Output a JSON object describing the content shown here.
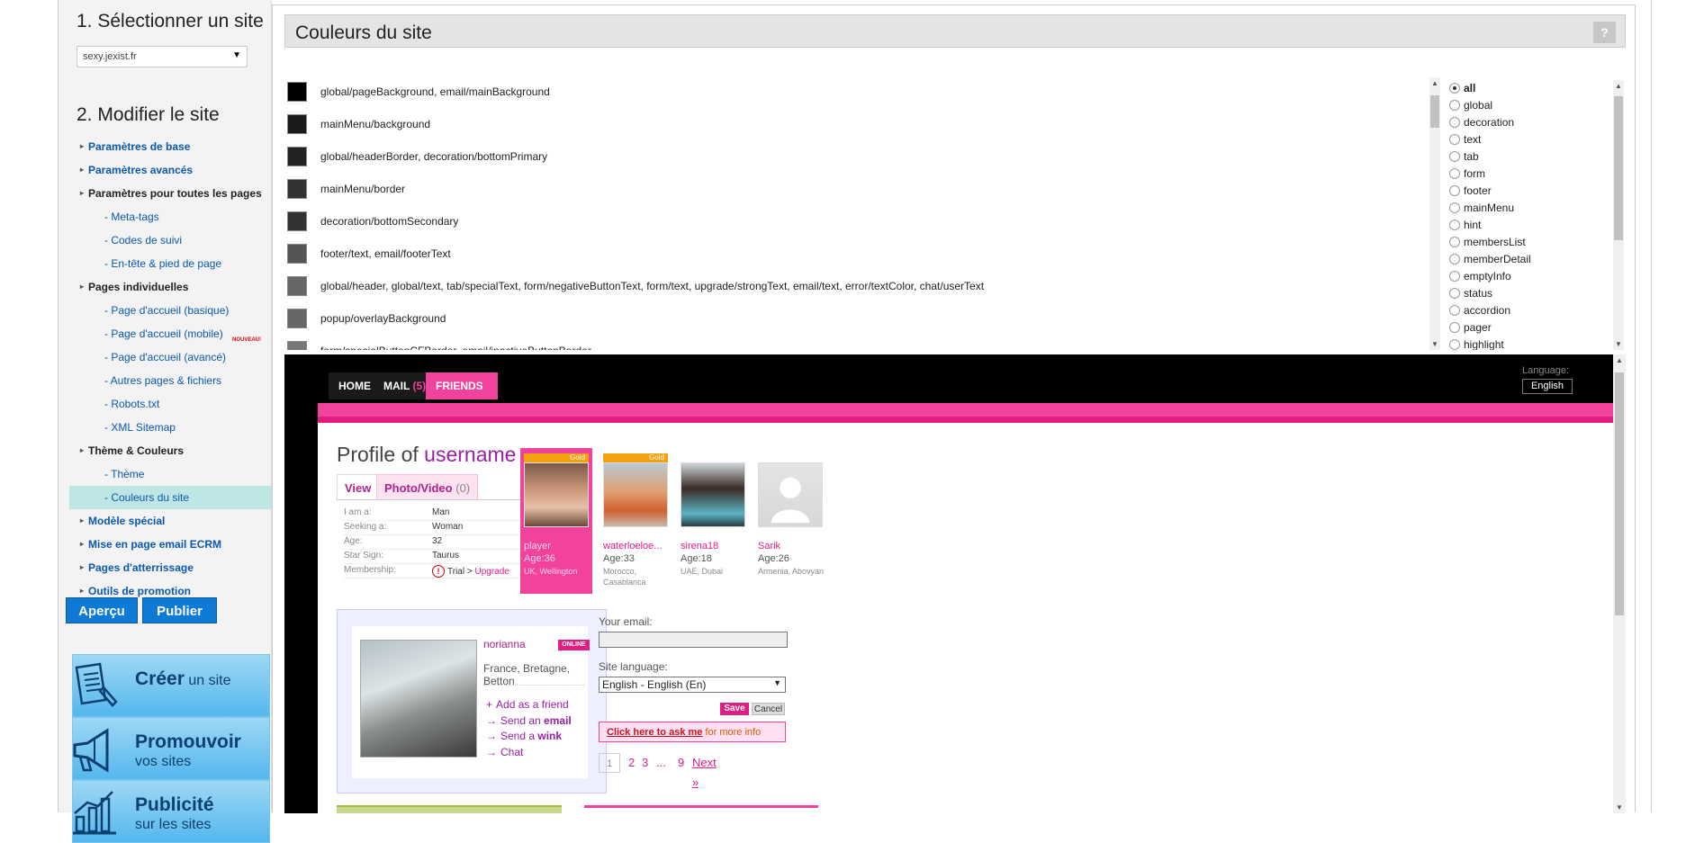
{
  "sidebar": {
    "step1_title": "1. Sélectionner un site",
    "site_value": "sexy.jexist.fr",
    "step2_title": "2. Modifier le site",
    "menu": [
      {
        "label": "Paramètres de base",
        "kind": "item"
      },
      {
        "label": "Paramètres avancés",
        "kind": "item"
      },
      {
        "label": "Paramètres pour toutes les pages",
        "kind": "item-dark"
      },
      {
        "label": "- Meta-tags",
        "kind": "sub"
      },
      {
        "label": "- Codes de suivi",
        "kind": "sub"
      },
      {
        "label": "- En-tête & pied de page",
        "kind": "sub"
      },
      {
        "label": "Pages individuelles",
        "kind": "item-dark"
      },
      {
        "label": "- Page d'accueil (basique)",
        "kind": "sub"
      },
      {
        "label": "- Page d'accueil (mobile)",
        "kind": "sub",
        "badge": "NOUVEAU!"
      },
      {
        "label": "- Page d'accueil (avancé)",
        "kind": "sub"
      },
      {
        "label": "- Autres pages & fichiers",
        "kind": "sub"
      },
      {
        "label": "- Robots.txt",
        "kind": "sub"
      },
      {
        "label": "- XML Sitemap",
        "kind": "sub"
      },
      {
        "label": "Thème & Couleurs",
        "kind": "item-dark"
      },
      {
        "label": "- Thème",
        "kind": "sub"
      },
      {
        "label": "- Couleurs du site",
        "kind": "sub-active"
      },
      {
        "label": "Modèle spécial",
        "kind": "item"
      },
      {
        "label": "Mise en page email ECRM",
        "kind": "item"
      },
      {
        "label": "Pages d'atterrissage",
        "kind": "item"
      },
      {
        "label": "Outils de promotion",
        "kind": "item"
      }
    ],
    "preview_button": "Aperçu",
    "publish_button": "Publier",
    "promos": [
      {
        "big": "Créer",
        "small": " un site",
        "line2": "",
        "icon": "document-pen-icon"
      },
      {
        "big": "Promouvoir",
        "small": "",
        "line2": "vos sites",
        "icon": "megaphone-icon"
      },
      {
        "big": "Publicité",
        "small": "",
        "line2": "sur les sites",
        "icon": "bar-chart-icon"
      }
    ]
  },
  "panel": {
    "title": "Couleurs du site",
    "help": "?",
    "colors": [
      {
        "swatch": "#000000",
        "label": "global/pageBackground, email/mainBackground"
      },
      {
        "swatch": "#1a1a1a",
        "label": "mainMenu/background"
      },
      {
        "swatch": "#222222",
        "label": "global/headerBorder, decoration/bottomPrimary"
      },
      {
        "swatch": "#333333",
        "label": "mainMenu/border"
      },
      {
        "swatch": "#333333",
        "label": "decoration/bottomSecondary"
      },
      {
        "swatch": "#555555",
        "label": "footer/text, email/footerText"
      },
      {
        "swatch": "#666666",
        "label": "global/header, global/text, tab/specialText, form/negativeButtonText, form/text, upgrade/strongText, email/text, error/textColor, chat/userText"
      },
      {
        "swatch": "#666666",
        "label": "popup/overlayBackground"
      },
      {
        "swatch": "#777777",
        "label": "form/specialButtonCFBorder, email/inactiveButtonBorder"
      }
    ],
    "filters": [
      {
        "label": "all",
        "selected": true
      },
      {
        "label": "global"
      },
      {
        "label": "decoration"
      },
      {
        "label": "text"
      },
      {
        "label": "tab"
      },
      {
        "label": "form"
      },
      {
        "label": "footer"
      },
      {
        "label": "mainMenu"
      },
      {
        "label": "hint"
      },
      {
        "label": "membersList"
      },
      {
        "label": "memberDetail"
      },
      {
        "label": "emptyInfo"
      },
      {
        "label": "status"
      },
      {
        "label": "accordion"
      },
      {
        "label": "pager"
      },
      {
        "label": "highlight"
      }
    ]
  },
  "preview": {
    "tabs": [
      {
        "label": "HOME"
      },
      {
        "label": "MAIL",
        "count": "(5)"
      },
      {
        "label": "FRIENDS",
        "active": true
      }
    ],
    "language_label": "Language:",
    "language_value": "English",
    "profile_prefix": "Profile of",
    "profile_user": "username",
    "tab_view": "View",
    "tab_photo": "Photo/Video",
    "tab_photo_count": "(0)",
    "info": [
      {
        "k": "I am a:",
        "v": "Man"
      },
      {
        "k": "Seeking a:",
        "v": "Woman"
      },
      {
        "k": "Age:",
        "v": "32"
      },
      {
        "k": "Star Sign:",
        "v": "Taurus"
      },
      {
        "k": "Membership:",
        "v": "Trial > ",
        "up": "Upgrade"
      }
    ],
    "members": [
      {
        "name": "player",
        "age": "Age:36",
        "loc": "UK, Wellington",
        "gold": "Gold",
        "highlight": true
      },
      {
        "name": "waterloeloe...",
        "age": "Age:33",
        "loc": "Morocco, Casablanca",
        "gold": "Gold"
      },
      {
        "name": "sirena18",
        "age": "Age:18",
        "loc": "UAE, Dubai"
      },
      {
        "name": "Sarik",
        "age": "Age:26",
        "loc": "Armenia, Abovyan"
      }
    ],
    "card_name": "norianna",
    "online": "ONLINE",
    "card_loc": "France, Bretagne, Betton",
    "card_actions": [
      {
        "icon": "+",
        "pre": "Add as a friend",
        "bold": ""
      },
      {
        "icon": "→",
        "pre": "Send an ",
        "bold": "email"
      },
      {
        "icon": "→",
        "pre": "Send a ",
        "bold": "wink"
      },
      {
        "icon": "→",
        "pre": "Chat",
        "bold": ""
      }
    ],
    "email_label": "Your email:",
    "site_lang_label": "Site language:",
    "site_lang_value": "English - English (En)",
    "save": "Save",
    "cancel": "Cancel",
    "hint_link": "Click here to ask me",
    "hint_rest": " for more info",
    "pager": [
      "1",
      "2",
      "3",
      "...",
      "9",
      "Next »"
    ]
  },
  "colors": {
    "accent": "#f2439c",
    "link": "#0a58b0",
    "button": "#0e7ad6"
  }
}
